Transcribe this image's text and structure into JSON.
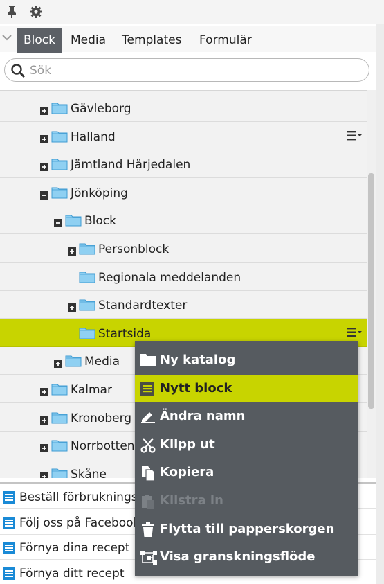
{
  "toolbar": {
    "icons": [
      "pin-icon",
      "gear-icon"
    ]
  },
  "tabs": [
    {
      "label": "Block",
      "active": true
    },
    {
      "label": "Media",
      "active": false
    },
    {
      "label": "Templates",
      "active": false
    },
    {
      "label": "Formulär",
      "active": false
    }
  ],
  "search": {
    "placeholder": "Sök"
  },
  "tree": [
    {
      "label": "Gävleborg",
      "expander": "plus"
    },
    {
      "label": "Halland",
      "expander": "plus",
      "has_menu": true
    },
    {
      "label": "Jämtland Härjedalen",
      "expander": "plus"
    },
    {
      "label": "Jönköping",
      "expander": "minus"
    },
    {
      "label": "Block",
      "expander": "minus"
    },
    {
      "label": "Personblock",
      "expander": "plus"
    },
    {
      "label": "Regionala meddelanden",
      "expander": "none"
    },
    {
      "label": "Standardtexter",
      "expander": "plus"
    },
    {
      "label": "Startsida",
      "expander": "none",
      "selected": true,
      "has_menu": true
    },
    {
      "label": "Media",
      "expander": "plus"
    },
    {
      "label": "Kalmar",
      "expander": "plus"
    },
    {
      "label": "Kronoberg",
      "expander": "plus"
    },
    {
      "label": "Norrbotten",
      "expander": "plus"
    },
    {
      "label": "Skåne",
      "expander": "plus"
    }
  ],
  "list": [
    {
      "label": "Beställ förbrukningsartiklar",
      "icon": "block-icon"
    },
    {
      "label": "Följ oss på Facebook",
      "icon": "block-icon"
    },
    {
      "label": "Förnya dina recept",
      "icon": "block-icon"
    },
    {
      "label": "Förnya ditt recept",
      "icon": "block-icon"
    }
  ],
  "context_menu": [
    {
      "label": "Ny katalog",
      "icon": "folder-icon"
    },
    {
      "label": "Nytt block",
      "icon": "block-icon",
      "highlighted": true
    },
    {
      "label": "Ändra namn",
      "icon": "rename-icon"
    },
    {
      "label": "Klipp ut",
      "icon": "scissors-icon"
    },
    {
      "label": "Kopiera",
      "icon": "copy-icon"
    },
    {
      "label": "Klistra in",
      "icon": "paste-icon",
      "disabled": true
    },
    {
      "label": "Flytta till papperskorgen",
      "icon": "trash-icon"
    },
    {
      "label": "Visa granskningsflöde",
      "icon": "workflow-icon"
    }
  ],
  "colors": {
    "accent": "#c8d400",
    "menu_bg": "#565b60",
    "tab_active": "#5c6066",
    "folder": "#7cc3ec",
    "block_icon": "#1a8ad6"
  }
}
